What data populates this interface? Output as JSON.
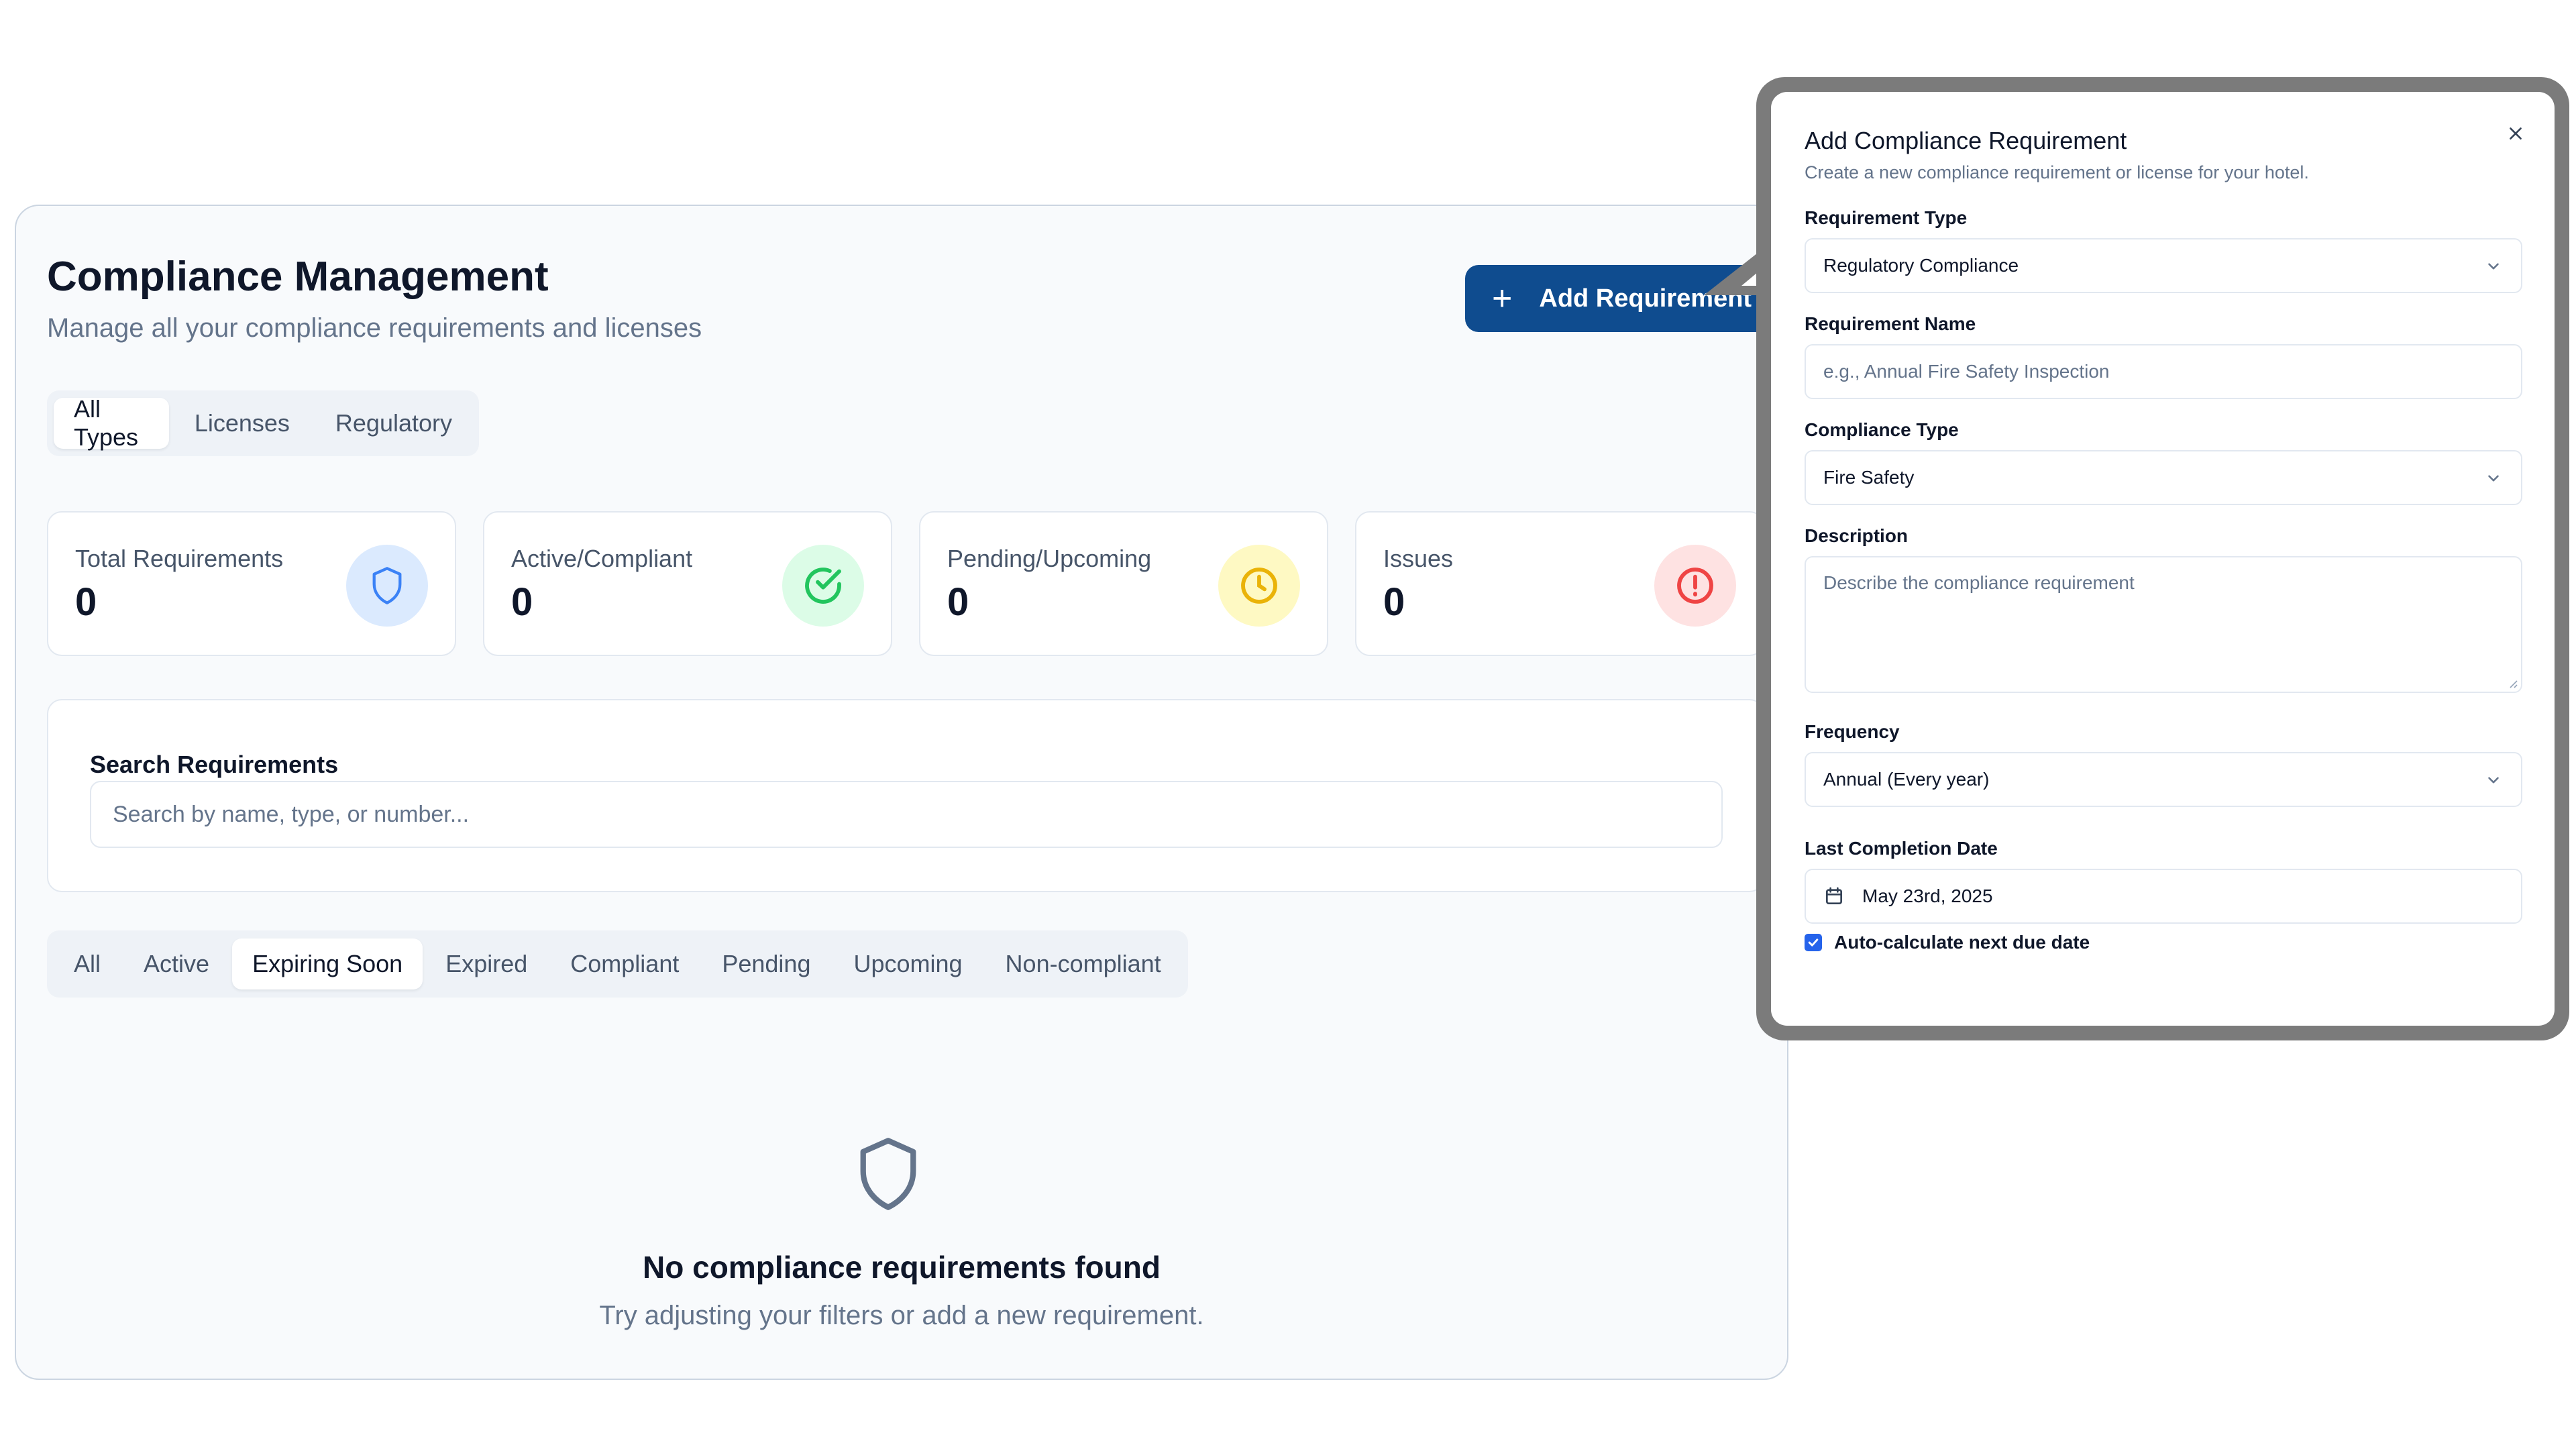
{
  "header": {
    "title": "Compliance Management",
    "subtitle": "Manage all your compliance requirements and licenses",
    "add_button_icon": "plus-icon",
    "add_button_label": "Add Requirement"
  },
  "type_tabs": [
    {
      "label": "All Types",
      "active": true
    },
    {
      "label": "Licenses",
      "active": false
    },
    {
      "label": "Regulatory",
      "active": false
    }
  ],
  "stats": [
    {
      "label": "Total Requirements",
      "value": "0",
      "icon": "shield-icon",
      "color": "#3b82f6",
      "bg": "#dbeafe"
    },
    {
      "label": "Active/Compliant",
      "value": "0",
      "icon": "check-circle-icon",
      "color": "#22c55e",
      "bg": "#dcfce7"
    },
    {
      "label": "Pending/Upcoming",
      "value": "0",
      "icon": "clock-icon",
      "color": "#eab308",
      "bg": "#fef9c3"
    },
    {
      "label": "Issues",
      "value": "0",
      "icon": "alert-circle-icon",
      "color": "#ef4444",
      "bg": "#fee2e2"
    }
  ],
  "search": {
    "label": "Search Requirements",
    "placeholder": "Search by name, type, or number..."
  },
  "status_tabs": [
    {
      "label": "All",
      "active": false
    },
    {
      "label": "Active",
      "active": false
    },
    {
      "label": "Expiring Soon",
      "active": true
    },
    {
      "label": "Expired",
      "active": false
    },
    {
      "label": "Compliant",
      "active": false
    },
    {
      "label": "Pending",
      "active": false
    },
    {
      "label": "Upcoming",
      "active": false
    },
    {
      "label": "Non-compliant",
      "active": false
    }
  ],
  "empty_state": {
    "icon": "shield-icon",
    "title": "No compliance requirements found",
    "subtitle": "Try adjusting your filters or add a new requirement."
  },
  "dialog": {
    "title": "Add Compliance Requirement",
    "description": "Create a new compliance requirement or license for your hotel.",
    "close_icon": "close-icon",
    "requirement_type": {
      "label": "Requirement Type",
      "value": "Regulatory Compliance"
    },
    "requirement_name": {
      "label": "Requirement Name",
      "placeholder": "e.g., Annual Fire Safety Inspection"
    },
    "compliance_type": {
      "label": "Compliance Type",
      "value": "Fire Safety"
    },
    "description_field": {
      "label": "Description",
      "placeholder": "Describe the compliance requirement"
    },
    "frequency": {
      "label": "Frequency",
      "value": "Annual (Every year)"
    },
    "last_completion": {
      "label": "Last Completion Date",
      "value": "May 23rd, 2025",
      "icon": "calendar-icon"
    },
    "auto_calc": {
      "label": "Auto-calculate next due date",
      "checked": true
    }
  },
  "colors": {
    "primary": "#0f4c8f",
    "checkbox": "#2563eb",
    "muted_text": "#64748b"
  }
}
